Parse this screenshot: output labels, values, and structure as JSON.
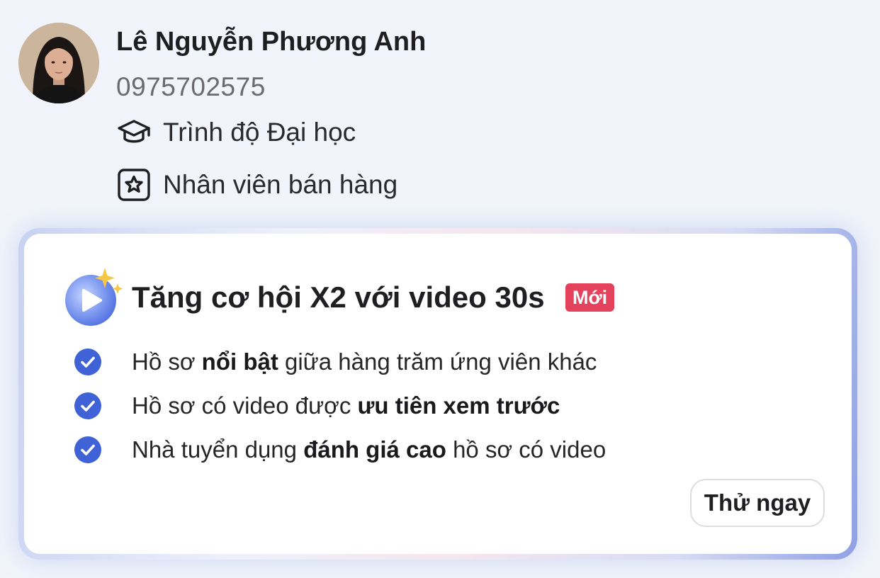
{
  "profile": {
    "name": "Lê Nguyễn Phương Anh",
    "phone": "0975702575",
    "education": "Trình độ Đại học",
    "job_title": "Nhân viên bán hàng",
    "education_icon": "graduation-cap-icon",
    "job_icon": "star-badge-icon"
  },
  "promo": {
    "title": "Tăng cơ hội X2 với video 30s",
    "badge": "Mới",
    "badge_color": "#e3415c",
    "icon": "video-play-sparkle-icon",
    "benefits": [
      {
        "pre": "Hồ sơ ",
        "bold": "nổi bật",
        "post": " giữa hàng trăm ứng viên khác"
      },
      {
        "pre": "Hồ sơ có video được ",
        "bold": "ưu tiên xem trước",
        "post": ""
      },
      {
        "pre": "Nhà tuyển dụng ",
        "bold": "đánh giá cao",
        "post": " hồ sơ có video"
      }
    ],
    "check_color": "#3f63d6",
    "cta_label": "Thử ngay"
  }
}
